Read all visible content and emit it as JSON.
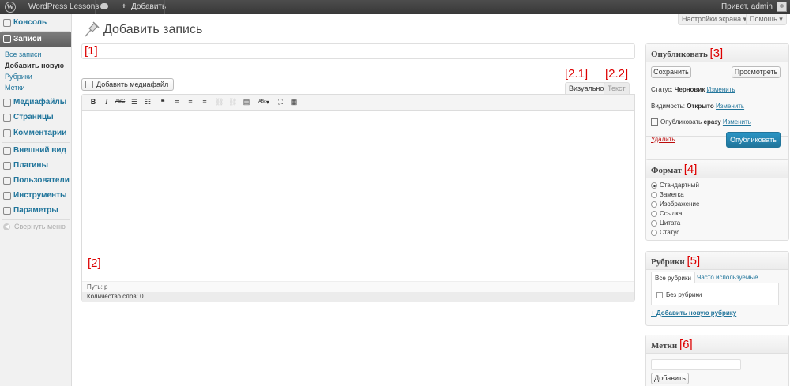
{
  "adminbar": {
    "logo_letter": "W",
    "site_name": "WordPress Lessons",
    "new_plus": "+",
    "new_label": "Добавить",
    "howdy": "Привет, admin"
  },
  "sidebar": {
    "items": [
      {
        "label": "Консоль",
        "icon": "dashboard-icon"
      },
      {
        "label": "Записи",
        "icon": "pin-icon"
      },
      {
        "label": "Медиафайлы",
        "icon": "media-icon"
      },
      {
        "label": "Страницы",
        "icon": "pages-icon"
      },
      {
        "label": "Комментарии",
        "icon": "comments-icon"
      },
      {
        "label": "Внешний вид",
        "icon": "appearance-icon"
      },
      {
        "label": "Плагины",
        "icon": "plugins-icon"
      },
      {
        "label": "Пользователи",
        "icon": "users-icon"
      },
      {
        "label": "Инструменты",
        "icon": "tools-icon"
      },
      {
        "label": "Параметры",
        "icon": "settings-icon"
      }
    ],
    "submenu": [
      "Все записи",
      "Добавить новую",
      "Рубрики",
      "Метки"
    ],
    "collapse": "Свернуть меню",
    "collapse_arrow": "◀"
  },
  "screen_options": "Настройки экрана ▾",
  "help": "Помощь ▾",
  "page_title": "Добавить запись",
  "annotations": {
    "title": "[1]",
    "editor": "[2]",
    "visual": "[2.1]",
    "text": "[2.2]",
    "publish": "[3]",
    "format": "[4]",
    "categories": "[5]",
    "tags": "[6]"
  },
  "editor": {
    "add_media": "Добавить медиафайл",
    "tab_visual": "Визуально",
    "tab_text": "Текст",
    "path": "Путь: p",
    "word_count": "Количество слов: 0",
    "toolbar": {
      "bold": "B",
      "italic": "I",
      "strike": "ABC",
      "ul": "☰",
      "ol": "☷",
      "quote": "❝",
      "align_left": "≡",
      "align_center": "≡",
      "align_right": "≡",
      "link": "⛓",
      "unlink": "⛓",
      "more": "▤",
      "spell": "ᴬᴮᶜ▾",
      "fullscreen": "⛶",
      "kitchen": "▦"
    }
  },
  "publish_box": {
    "title": "Опубликовать",
    "save_draft": "Сохранить",
    "preview": "Просмотреть",
    "status_label": "Статус:",
    "status_value": "Черновик",
    "status_edit": "Изменить",
    "visibility_label": "Видимость:",
    "visibility_value": "Открыто",
    "visibility_edit": "Изменить",
    "schedule_label": "Опубликовать",
    "schedule_value": "сразу",
    "schedule_edit": "Изменить",
    "delete": "Удалить",
    "publish": "Опубликовать"
  },
  "format_box": {
    "title": "Формат",
    "options": [
      "Стандартный",
      "Заметка",
      "Изображение",
      "Ссылка",
      "Цитата",
      "Статус"
    ],
    "selected": 0
  },
  "categories_box": {
    "title": "Рубрики",
    "tab_all": "Все рубрики",
    "tab_popular": "Часто используемые",
    "items": [
      "Без рубрики"
    ],
    "add_new": "+ Добавить новую рубрику"
  },
  "tags_box": {
    "title": "Метки",
    "add": "Добавить"
  }
}
